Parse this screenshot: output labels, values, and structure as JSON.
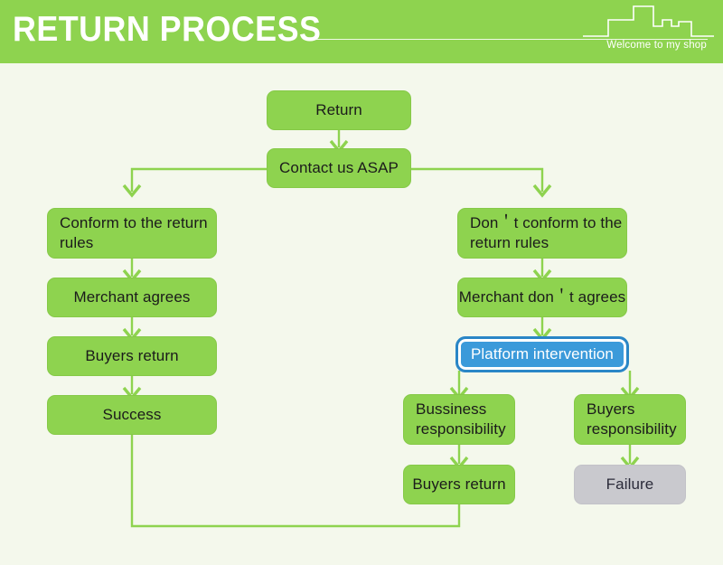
{
  "header": {
    "title": "RETURN PROCESS",
    "tagline": "Welcome to my shop",
    "brand_green": "#8ed34f",
    "skyline_icon": "city-skyline-icon"
  },
  "page": {
    "background": "#f4f8ec"
  },
  "flowchart": {
    "type": "flowchart",
    "nodes": [
      {
        "id": "return",
        "label": "Return",
        "style": "green",
        "align": "center"
      },
      {
        "id": "contact",
        "label": "Contact us ASAP",
        "style": "green",
        "align": "center"
      },
      {
        "id": "conform",
        "label": "Conform to the return rules",
        "style": "green",
        "align": "left"
      },
      {
        "id": "merchant-ok",
        "label": "Merchant agrees",
        "style": "green",
        "align": "center"
      },
      {
        "id": "buyers-return-left",
        "label": "Buyers return",
        "style": "green",
        "align": "center"
      },
      {
        "id": "success",
        "label": "Success",
        "style": "green",
        "align": "center"
      },
      {
        "id": "not-conform",
        "label": "Don＇t conform to the return rules",
        "style": "green",
        "align": "left"
      },
      {
        "id": "merchant-no",
        "label": "Merchant don＇t agrees",
        "style": "green",
        "align": "center"
      },
      {
        "id": "platform",
        "label": "Platform intervention",
        "style": "blue",
        "align": "center"
      },
      {
        "id": "business-resp",
        "label": "Bussiness responsibility",
        "style": "green",
        "align": "left"
      },
      {
        "id": "buyers-resp",
        "label": "Buyers responsibility",
        "style": "green",
        "align": "left"
      },
      {
        "id": "buyers-return-right",
        "label": "Buyers return",
        "style": "green",
        "align": "center"
      },
      {
        "id": "failure",
        "label": "Failure",
        "style": "gray",
        "align": "center"
      }
    ],
    "edges": [
      {
        "from": "return",
        "to": "contact"
      },
      {
        "from": "contact",
        "to": "conform"
      },
      {
        "from": "contact",
        "to": "not-conform"
      },
      {
        "from": "conform",
        "to": "merchant-ok"
      },
      {
        "from": "merchant-ok",
        "to": "buyers-return-left"
      },
      {
        "from": "buyers-return-left",
        "to": "success"
      },
      {
        "from": "not-conform",
        "to": "merchant-no"
      },
      {
        "from": "merchant-no",
        "to": "platform"
      },
      {
        "from": "platform",
        "to": "business-resp"
      },
      {
        "from": "platform",
        "to": "buyers-resp"
      },
      {
        "from": "business-resp",
        "to": "buyers-return-right"
      },
      {
        "from": "buyers-resp",
        "to": "failure"
      },
      {
        "from": "buyers-return-right",
        "to": "success"
      }
    ],
    "colors": {
      "node_green": "#8ed34f",
      "node_gray": "#c9c9ce",
      "node_blue": "#3b9ada",
      "connector": "#8ed34f"
    }
  }
}
